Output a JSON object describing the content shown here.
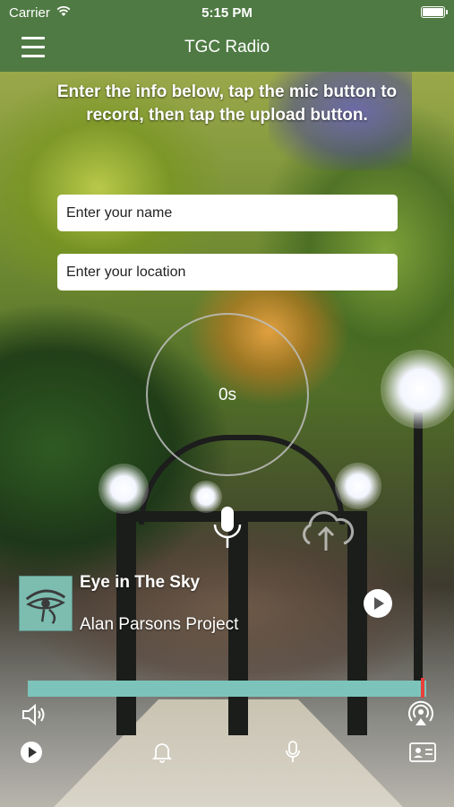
{
  "status_bar": {
    "carrier": "Carrier",
    "time": "5:15 PM"
  },
  "nav": {
    "title": "TGC Radio"
  },
  "instructions": "Enter the info below, tap the mic button to record, then tap the upload button.",
  "form": {
    "name_placeholder": "Enter your name",
    "name_value": "",
    "location_placeholder": "Enter your location",
    "location_value": ""
  },
  "recorder": {
    "elapsed": "0s"
  },
  "now_playing": {
    "title": "Eye in The Sky",
    "artist": "Alan Parsons Project",
    "progress_fraction": 0.99
  },
  "toolbar": {
    "icons": [
      "volume-icon",
      "airplay-icon",
      "play-icon",
      "bell-icon",
      "microphone-icon",
      "contact-card-icon"
    ]
  },
  "colors": {
    "header": "#4f7a44",
    "progress": "#7cc4bb",
    "progress_thumb": "#e8403c",
    "album_art": "#7cbdb0"
  }
}
